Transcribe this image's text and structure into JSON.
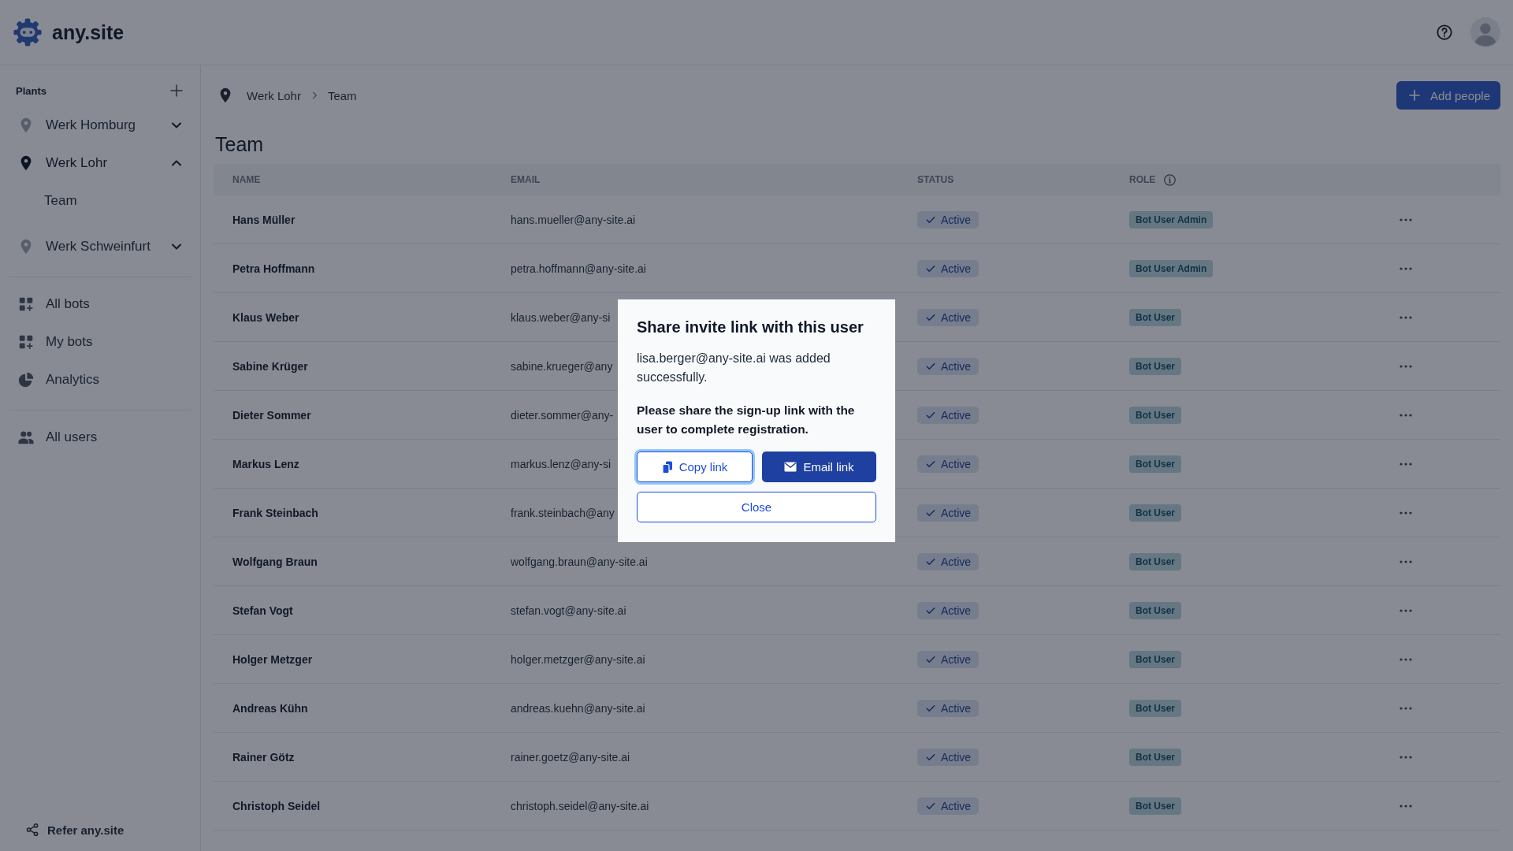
{
  "header": {
    "logo_text": "any.site"
  },
  "sidebar": {
    "section_title": "Plants",
    "plants": [
      {
        "name": "Werk Homburg",
        "selected": false,
        "expanded": false
      },
      {
        "name": "Werk Lohr",
        "selected": true,
        "expanded": true,
        "children": [
          {
            "label": "Team"
          }
        ]
      },
      {
        "name": "Werk Schweinfurt",
        "selected": false,
        "expanded": false
      }
    ],
    "nav": [
      [
        {
          "label": "All bots",
          "kind": "bots"
        },
        {
          "label": "My bots",
          "kind": "bots"
        },
        {
          "label": "Analytics",
          "kind": "analytics"
        }
      ],
      [
        {
          "label": "All users",
          "kind": "users"
        }
      ]
    ],
    "footer_link": "Refer any.site"
  },
  "breadcrumb": [
    "Werk Lohr",
    "Team"
  ],
  "add_button": "Add people",
  "page_title": "Team",
  "table": {
    "columns": [
      "NAME",
      "EMAIL",
      "STATUS",
      "ROLE"
    ],
    "rows": [
      {
        "name": "Hans Müller",
        "email": "hans.mueller@any-site.ai",
        "status": "Active",
        "role": "Bot User Admin"
      },
      {
        "name": "Petra Hoffmann",
        "email": "petra.hoffmann@any-site.ai",
        "status": "Active",
        "role": "Bot User Admin"
      },
      {
        "name": "Klaus Weber",
        "email": "klaus.weber@any-si",
        "status": "Active",
        "role": "Bot User"
      },
      {
        "name": "Sabine Krüger",
        "email": "sabine.krueger@any",
        "status": "Active",
        "role": "Bot User"
      },
      {
        "name": "Dieter Sommer",
        "email": "dieter.sommer@any-",
        "status": "Active",
        "role": "Bot User"
      },
      {
        "name": "Markus Lenz",
        "email": "markus.lenz@any-si",
        "status": "Active",
        "role": "Bot User"
      },
      {
        "name": "Frank Steinbach",
        "email": "frank.steinbach@any",
        "status": "Active",
        "role": "Bot User"
      },
      {
        "name": "Wolfgang Braun",
        "email": "wolfgang.braun@any-site.ai",
        "status": "Active",
        "role": "Bot User"
      },
      {
        "name": "Stefan Vogt",
        "email": "stefan.vogt@any-site.ai",
        "status": "Active",
        "role": "Bot User"
      },
      {
        "name": "Holger Metzger",
        "email": "holger.metzger@any-site.ai",
        "status": "Active",
        "role": "Bot User"
      },
      {
        "name": "Andreas Kühn",
        "email": "andreas.kuehn@any-site.ai",
        "status": "Active",
        "role": "Bot User"
      },
      {
        "name": "Rainer Götz",
        "email": "rainer.goetz@any-site.ai",
        "status": "Active",
        "role": "Bot User"
      },
      {
        "name": "Christoph Seidel",
        "email": "christoph.seidel@any-site.ai",
        "status": "Active",
        "role": "Bot User"
      }
    ]
  },
  "dialog": {
    "title": "Share invite link with this user",
    "message": "lisa.berger@any-site.ai was added successfully.",
    "instruction": "Please share the sign-up link with the user to complete registration.",
    "copy_button": "Copy link",
    "email_button": "Email link",
    "close_button": "Close"
  }
}
